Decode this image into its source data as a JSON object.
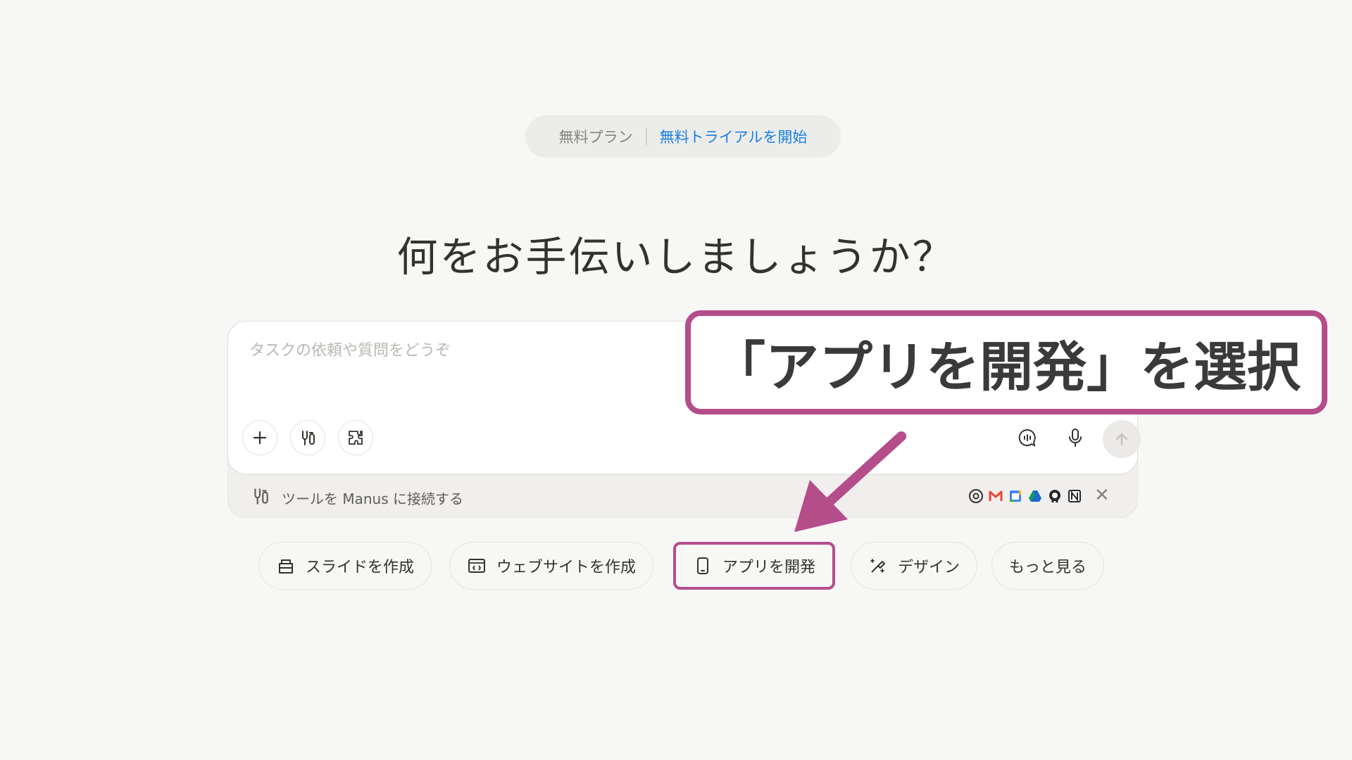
{
  "plan": {
    "current": "無料プラン",
    "trial_link": "無料トライアルを開始"
  },
  "greeting": "何をお手伝いしましょうか？",
  "composer": {
    "placeholder": "タスクの依頼や質問をどうぞ"
  },
  "connect": {
    "text": "ツールを Manus に接続する"
  },
  "quick_actions": [
    {
      "label": "スライドを作成",
      "icon": "presentation-icon"
    },
    {
      "label": "ウェブサイトを作成",
      "icon": "browser-icon"
    },
    {
      "label": "アプリを開発",
      "icon": "phone-icon"
    },
    {
      "label": "デザイン",
      "icon": "design-icon"
    },
    {
      "label": "もっと見る",
      "icon": ""
    }
  ],
  "annotation": {
    "text": "「アプリを開発」を選択",
    "color": "#b54d8b"
  },
  "colors": {
    "accent_link": "#1a7fe0",
    "highlight": "#b54d8b"
  }
}
